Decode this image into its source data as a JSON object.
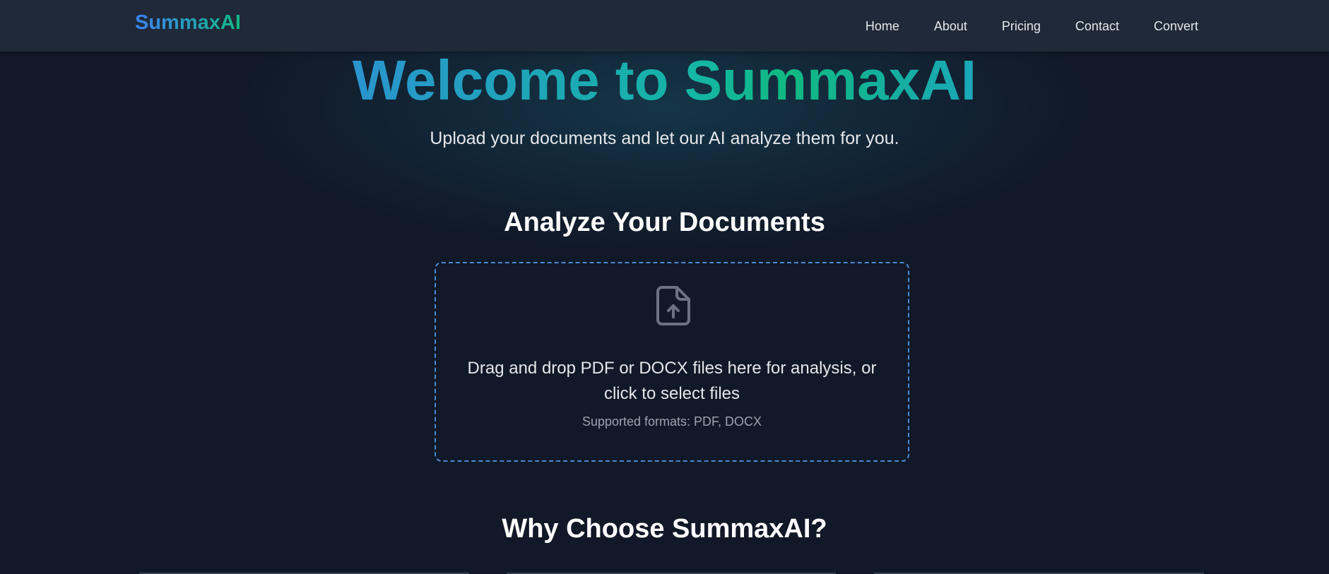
{
  "nav": {
    "brand": "SummaxAI",
    "links": [
      "Home",
      "About",
      "Pricing",
      "Contact",
      "Convert"
    ]
  },
  "hero": {
    "title": "Welcome to SummaxAI",
    "subtitle": "Upload your documents and let our AI analyze them for you."
  },
  "analyze": {
    "title": "Analyze Your Documents",
    "dropzone": {
      "icon": "file-upload-icon",
      "text_line1": "Drag and drop PDF or DOCX files here for analysis, or",
      "text_line2": "click to select files",
      "formats": "Supported formats: PDF, DOCX"
    }
  },
  "features": {
    "title": "Why Choose SummaxAI?"
  },
  "colors": {
    "background": "#111827",
    "navbar": "#1f2937",
    "accent_blue": "#3b82f6",
    "accent_green": "#10b981",
    "dropzone_border": "#4a8ad6"
  }
}
